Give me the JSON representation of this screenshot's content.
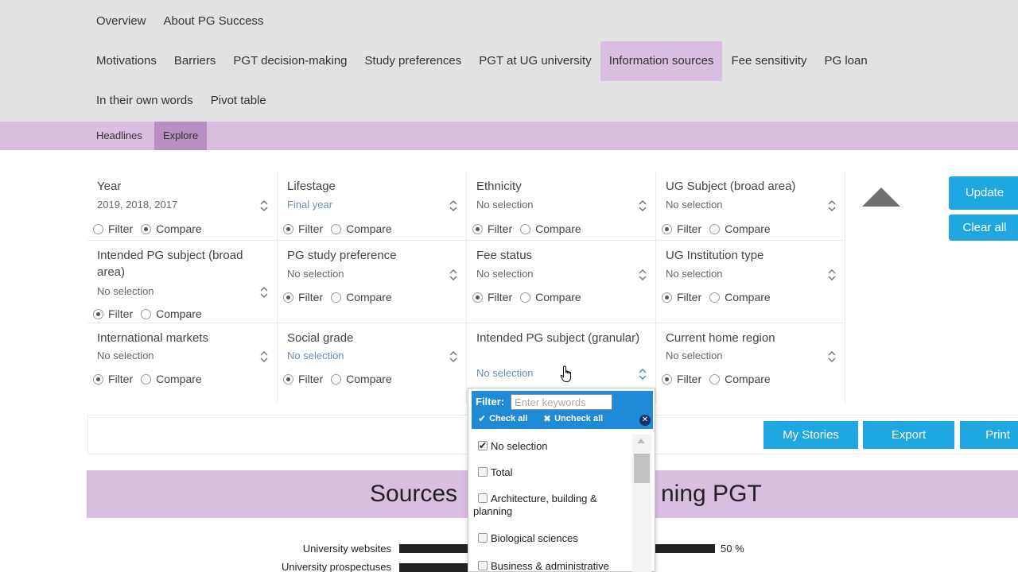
{
  "nav": {
    "row1": [
      "Overview",
      "About PG Success"
    ],
    "row2": [
      "Motivations",
      "Barriers",
      "PGT decision-making",
      "Study preferences",
      "PGT at UG university",
      "Information sources",
      "Fee sensitivity",
      "PG loan"
    ],
    "row3": [
      "In their own words",
      "Pivot table"
    ],
    "active": "Information sources"
  },
  "subnav": {
    "headlines": "Headlines",
    "explore": "Explore"
  },
  "radio_labels": {
    "filter": "Filter",
    "compare": "Compare"
  },
  "filters": [
    {
      "label": "Year",
      "value": "2019, 2018, 2017",
      "mode": "compare"
    },
    {
      "label": "Lifestage",
      "value": "Final year",
      "mode": "filter"
    },
    {
      "label": "Ethnicity",
      "value": "No selection",
      "mode": "filter"
    },
    {
      "label": "UG Subject (broad area)",
      "value": "No selection",
      "mode": "filter"
    },
    {
      "label": "Intended PG subject (broad area)",
      "value": "No selection",
      "mode": "filter"
    },
    {
      "label": "PG study preference",
      "value": "No selection",
      "mode": "filter"
    },
    {
      "label": "Fee status",
      "value": "No selection",
      "mode": "filter"
    },
    {
      "label": "UG Institution type",
      "value": "No selection",
      "mode": "filter"
    },
    {
      "label": "International markets",
      "value": "No selection",
      "mode": "filter"
    },
    {
      "label": "Social grade",
      "value": "No selection",
      "mode": "filter"
    },
    {
      "label": "Intended PG subject (granular)",
      "value": "No selection",
      "mode": "filter"
    },
    {
      "label": "Current home region",
      "value": "No selection",
      "mode": "filter"
    }
  ],
  "buttons": {
    "update": "Update",
    "clear_all": "Clear all",
    "my_stories": "My Stories",
    "export": "Export",
    "print": "Print"
  },
  "banner": {
    "title_left": "Sources",
    "title_right": "ning PGT"
  },
  "chart_rows": [
    {
      "label": "University websites",
      "value_text": "50 %"
    },
    {
      "label": "University prospectuses",
      "value_text": ""
    }
  ],
  "dropdown": {
    "filter_label": "Filter:",
    "placeholder": "Enter keywords",
    "check_all": "Check all",
    "uncheck_all": "Uncheck all",
    "options": [
      {
        "label": "No selection",
        "checked": true
      },
      {
        "label": "Total",
        "checked": false
      },
      {
        "label": "Architecture, building & planning",
        "checked": false
      },
      {
        "label": "Biological sciences",
        "checked": false
      },
      {
        "label": "Business & administrative",
        "checked": false
      }
    ]
  },
  "colors": {
    "nav_bg": "#e2e2e2",
    "accent_purple": "#d9bfdf",
    "button_blue": "#1fa7e1"
  }
}
